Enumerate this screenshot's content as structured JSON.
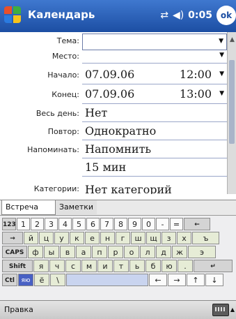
{
  "titlebar": {
    "title": "Календарь",
    "time": "0:05",
    "ok_label": "ok",
    "icons": [
      "windows-start-icon",
      "connectivity-icon",
      "volume-icon"
    ]
  },
  "form": {
    "fields": [
      {
        "label": "Тема:",
        "value": "",
        "kind": "combo"
      },
      {
        "label": "Место:",
        "value": "",
        "kind": "combo"
      },
      {
        "label": "Начало:",
        "date": "07.09.06",
        "time": "12:00"
      },
      {
        "label": "Конец:",
        "date": "07.09.06",
        "time": "13:00"
      },
      {
        "label": "Весь день:",
        "value": "Нет"
      },
      {
        "label": "Повтор:",
        "value": "Однократно"
      },
      {
        "label": "Напоминать:",
        "value": "Напомнить"
      },
      {
        "label": "",
        "value": "15 мин"
      },
      {
        "label": "Категории:",
        "value": "Нет категорий"
      }
    ]
  },
  "tabs": {
    "active": "Встреча",
    "second": "Заметки"
  },
  "keyboard": {
    "rows": [
      [
        "123",
        "1",
        "2",
        "3",
        "4",
        "5",
        "6",
        "7",
        "8",
        "9",
        "0",
        "-",
        "=",
        "←"
      ],
      [
        "→",
        "й",
        "ц",
        "у",
        "к",
        "е",
        "н",
        "г",
        "ш",
        "щ",
        "з",
        "х",
        "ъ"
      ],
      [
        "CAPS",
        "ф",
        "ы",
        "в",
        "а",
        "п",
        "р",
        "о",
        "л",
        "д",
        "ж",
        "э"
      ],
      [
        "Shift",
        "я",
        "ч",
        "с",
        "м",
        "и",
        "т",
        "ь",
        "б",
        "ю",
        ".",
        "↵"
      ],
      [
        "Ctl",
        "яю",
        "ё",
        "\\",
        "",
        "←",
        "→",
        "↑",
        "↓"
      ]
    ]
  },
  "menubar": {
    "edit_label": "Правка"
  }
}
